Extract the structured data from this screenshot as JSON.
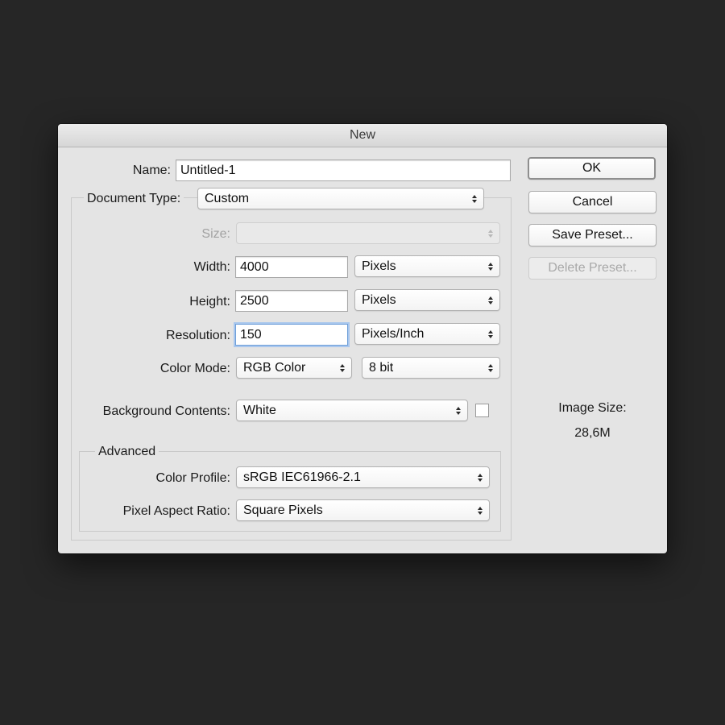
{
  "dialog": {
    "title": "New"
  },
  "form": {
    "name_label": "Name:",
    "name_value": "Untitled-1",
    "document_type_label": "Document Type:",
    "document_type_value": "Custom",
    "size_label": "Size:",
    "size_value": "",
    "width_label": "Width:",
    "width_value": "4000",
    "width_unit": "Pixels",
    "height_label": "Height:",
    "height_value": "2500",
    "height_unit": "Pixels",
    "resolution_label": "Resolution:",
    "resolution_value": "150",
    "resolution_unit": "Pixels/Inch",
    "color_mode_label": "Color Mode:",
    "color_mode_value": "RGB Color",
    "bit_depth_value": "8 bit",
    "background_label": "Background Contents:",
    "background_value": "White",
    "background_swatch_color": "#ffffff"
  },
  "advanced": {
    "legend": "Advanced",
    "color_profile_label": "Color Profile:",
    "color_profile_value": "sRGB IEC61966-2.1",
    "pixel_aspect_label": "Pixel Aspect Ratio:",
    "pixel_aspect_value": "Square Pixels"
  },
  "buttons": {
    "ok": "OK",
    "cancel": "Cancel",
    "save_preset": "Save Preset...",
    "delete_preset": "Delete Preset..."
  },
  "image_size": {
    "label": "Image Size:",
    "value": "28,6M"
  },
  "icons": {
    "select_arrows": "up-down-chevron-icon"
  },
  "colors": {
    "backdrop": "#262626",
    "dialog": "#e4e4e4",
    "focus_ring": "#6f9fd8"
  }
}
